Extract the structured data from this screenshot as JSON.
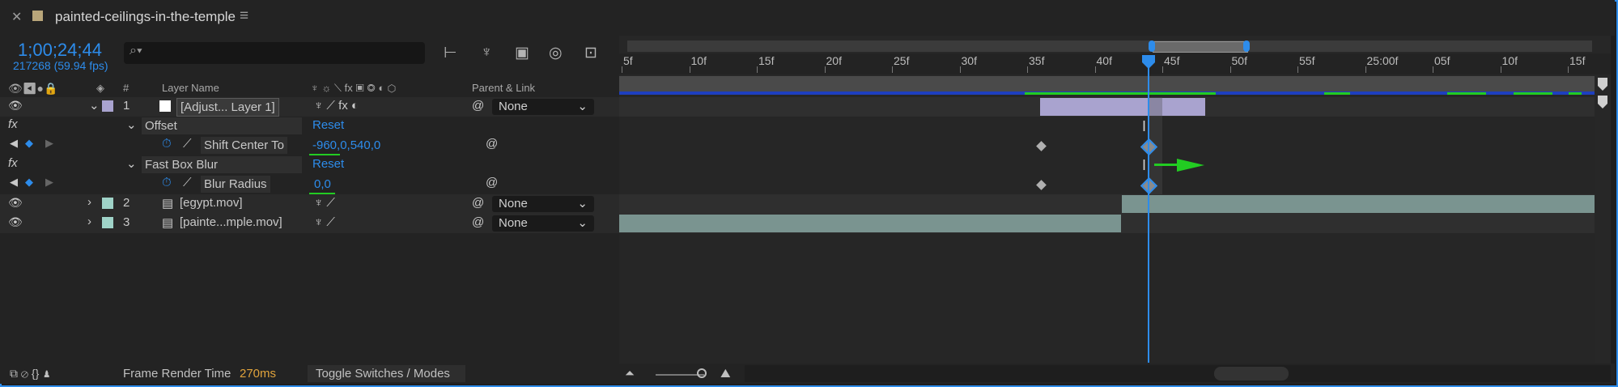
{
  "comp": {
    "tab_title": "painted-ceilings-in-the-temple",
    "timecode": "1;00;24;44",
    "fps": "217268 (59.94 fps)",
    "search_placeholder": ""
  },
  "headers": {
    "hash": "#",
    "layer_name": "Layer Name",
    "parent_link": "Parent & Link"
  },
  "layers": [
    {
      "num": "1",
      "name": "[Adjust... Layer 1]",
      "parent": "None",
      "swatch": "#a9a3cf"
    },
    {
      "num": "2",
      "name": "[egypt.mov]",
      "parent": "None",
      "swatch": "#9fd3c8"
    },
    {
      "num": "3",
      "name": "[painte...mple.mov]",
      "parent": "None",
      "swatch": "#9fd3c8"
    }
  ],
  "effects": [
    {
      "name": "Offset",
      "reset": "Reset",
      "prop": "Shift Center To",
      "value": "-960,0,540,0"
    },
    {
      "name": "Fast Box Blur",
      "reset": "Reset",
      "prop": "Blur Radius",
      "value": "0,0"
    }
  ],
  "ruler": [
    "5f",
    "10f",
    "15f",
    "20f",
    "25f",
    "30f",
    "35f",
    "40f",
    "45f",
    "50f",
    "55f",
    "25:00f",
    "05f",
    "10f",
    "15f"
  ],
  "bottom": {
    "frame_render_label": "Frame Render Time",
    "frame_render_value": "270ms",
    "toggle": "Toggle Switches / Modes"
  },
  "colors": {
    "accent": "#2d8ceb",
    "green": "#22cc22",
    "adjust_bar": "#a9a3cf",
    "clip_bar": "#7a9490"
  }
}
